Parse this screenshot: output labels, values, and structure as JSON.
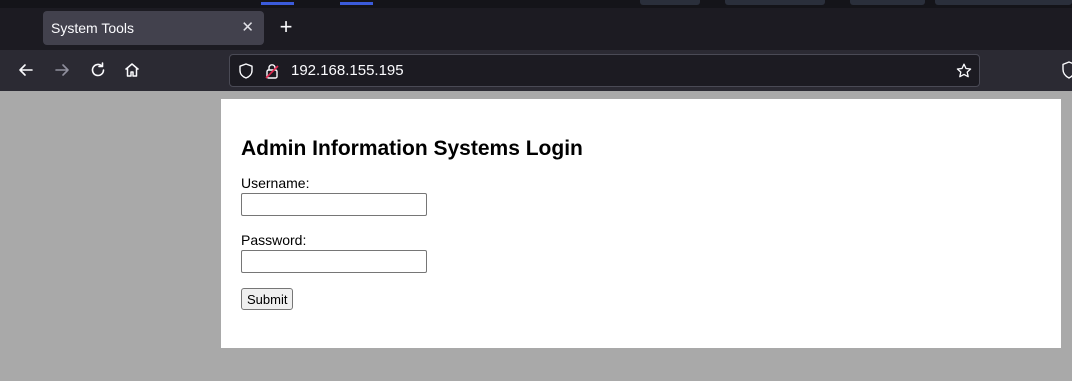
{
  "browser": {
    "tab_title": "System Tools",
    "tab_close_icon": "close-icon",
    "new_tab_label": "+",
    "url": "192.168.155.195",
    "icons": [
      "back-arrow-icon",
      "forward-arrow-icon",
      "reload-icon",
      "home-icon",
      "shield-icon",
      "insecure-lock-icon",
      "bookmark-star-icon",
      "extension-shield-icon"
    ]
  },
  "page": {
    "heading": "Admin Information Systems Login",
    "username_label": "Username:",
    "username_value": "",
    "password_label": "Password:",
    "password_value": "",
    "submit_label": "Submit"
  }
}
